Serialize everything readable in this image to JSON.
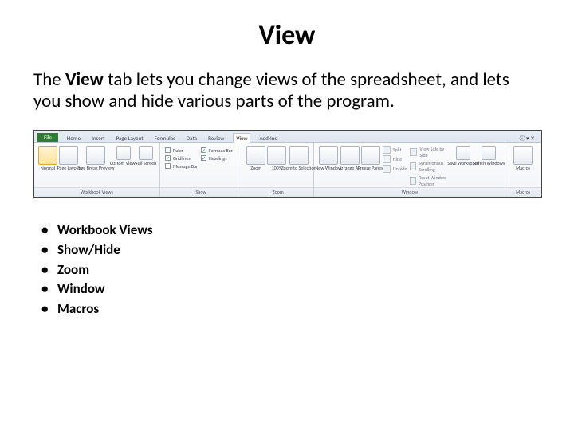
{
  "title": "View",
  "body": {
    "prefix": "The ",
    "tabname": "View",
    "rest": " tab lets you change views of the spreadsheet, and lets you show and hide various parts of the program."
  },
  "ribbon": {
    "tabs": [
      "File",
      "Home",
      "Insert",
      "Page Layout",
      "Formulas",
      "Data",
      "Review",
      "View",
      "Add-Ins"
    ],
    "active_tab": "View",
    "groups": {
      "workbook_views": {
        "label": "Workbook Views",
        "buttons": [
          "Normal",
          "Page Layout",
          "Page Break Preview",
          "Custom Views",
          "Full Screen"
        ]
      },
      "show": {
        "label": "Show",
        "checks_left": [
          "Ruler",
          "Gridlines",
          "Message Bar"
        ],
        "checks_right": [
          "Formula Bar",
          "Headings"
        ]
      },
      "zoom": {
        "label": "Zoom",
        "buttons": [
          "Zoom",
          "100%",
          "Zoom to Selection"
        ]
      },
      "window": {
        "label": "Window",
        "big_buttons": [
          "New Window",
          "Arrange All",
          "Freeze Panes"
        ],
        "small_left": [
          "Split",
          "Hide",
          "Unhide"
        ],
        "small_right": [
          "View Side by Side",
          "Synchronous Scrolling",
          "Reset Window Position"
        ],
        "tail_buttons": [
          "Save Workspace",
          "Switch Windows"
        ]
      },
      "macros": {
        "label": "Macros",
        "buttons": [
          "Macros"
        ]
      }
    }
  },
  "bullets": [
    "Workbook Views",
    "Show/Hide",
    "Zoom",
    "Window",
    "Macros"
  ]
}
